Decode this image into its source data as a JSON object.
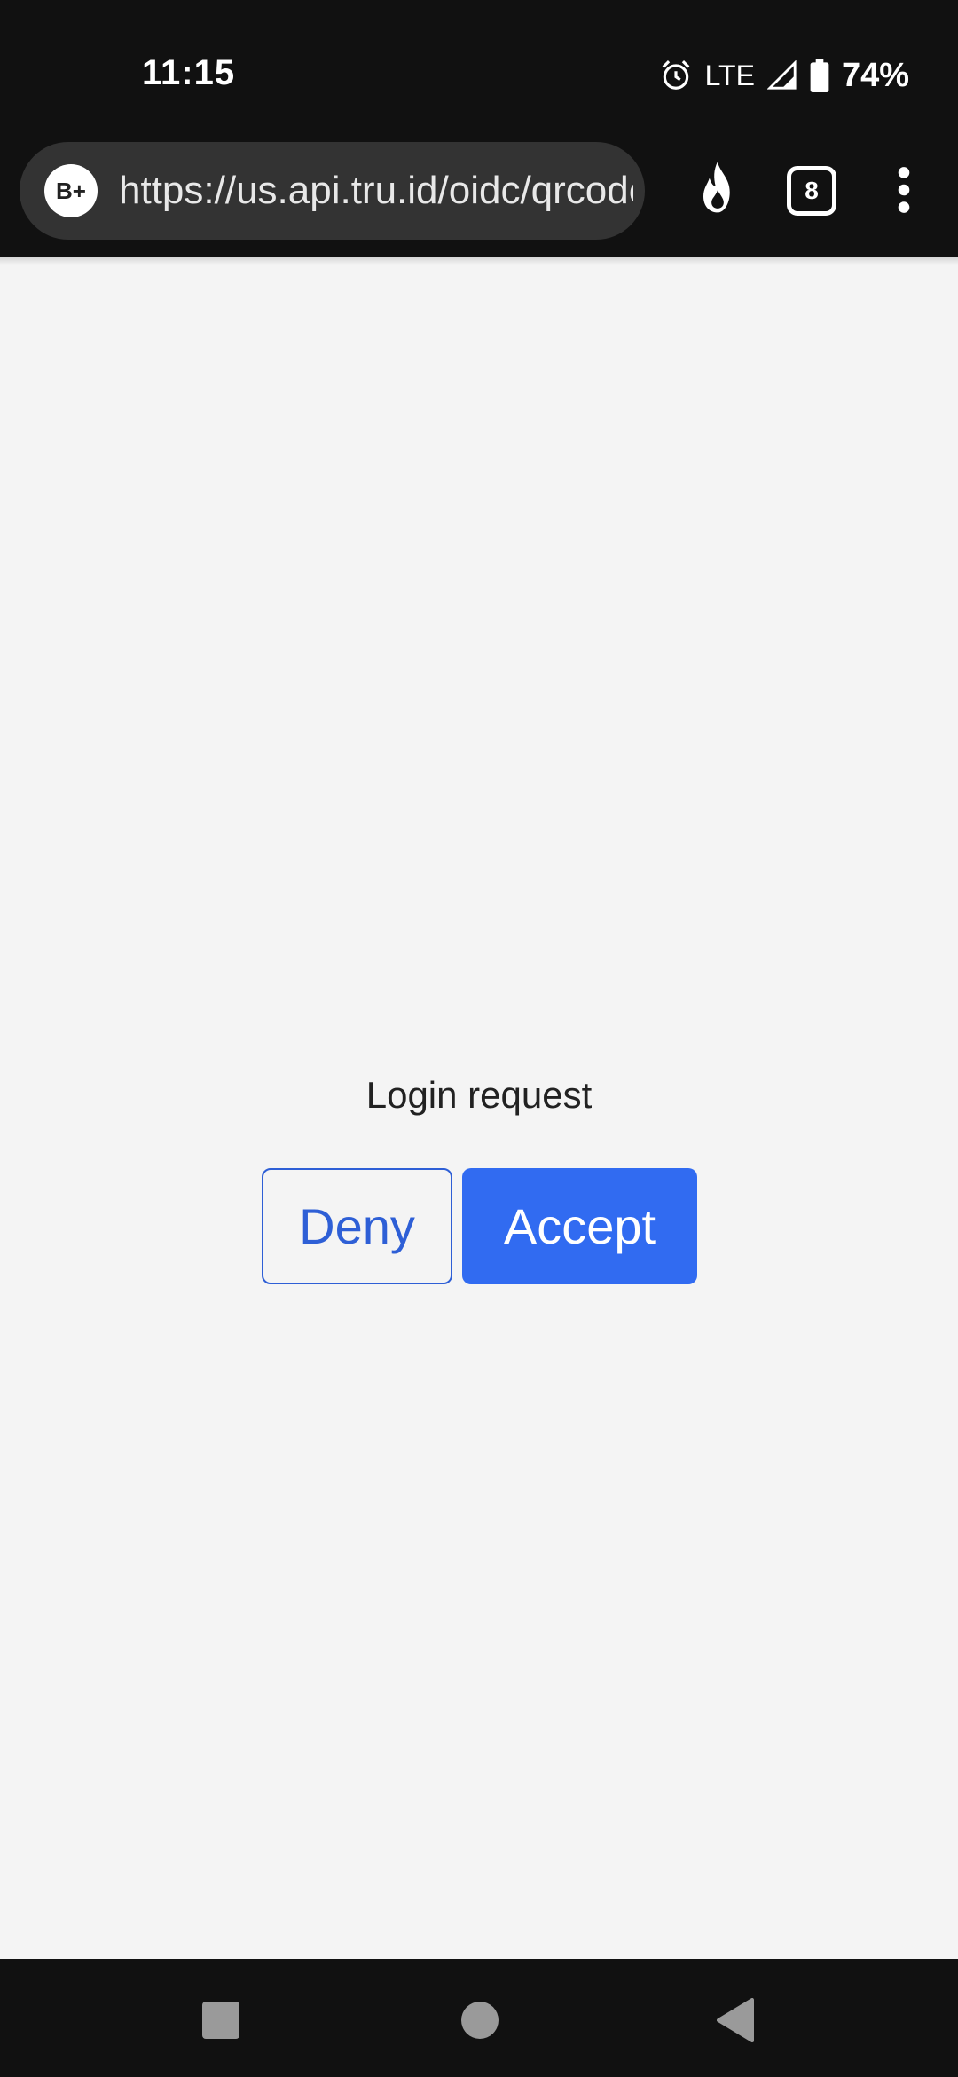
{
  "status_bar": {
    "time": "11:15",
    "network": "LTE",
    "battery": "74%",
    "icons": [
      "alarm-icon",
      "signal-icon",
      "battery-icon"
    ]
  },
  "browser": {
    "site_badge": "B+",
    "url": "https://us.api.tru.id/oidc/qrcode",
    "tab_count": "8",
    "icons": [
      "fire-icon",
      "tabs-icon",
      "overflow-menu-icon"
    ]
  },
  "page": {
    "title": "Login request",
    "deny_label": "Deny",
    "accept_label": "Accept"
  },
  "nav_bar": {
    "icons": [
      "recents-icon",
      "home-icon",
      "back-icon"
    ]
  },
  "colors": {
    "accent": "#316bf1",
    "deny_outline": "#2e5fd6",
    "page_background": "#f4f4f4",
    "bar_background": "#111111"
  }
}
